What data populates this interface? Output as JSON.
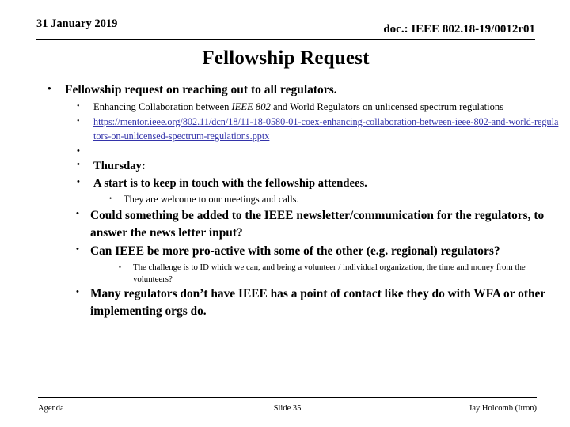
{
  "header": {
    "date": "31 January 2019",
    "doc": "doc.: IEEE 802.18-19/0012r01"
  },
  "title": "Fellowship Request",
  "content": {
    "b1": "Fellowship request on reaching out to all regulators.",
    "b1_1_pre": "Enhancing Collaboration between ",
    "b1_1_ital": "IEEE 802",
    "b1_1_post": " and World Regulators on unlicensed spectrum regulations",
    "b1_2_link": "https://mentor.ieee.org/802.11/dcn/18/11-18-0580-01-coex-enhancing-collaboration-between-ieee-802-and-world-regulators-on-unlicensed-spectrum-regulations.pptx",
    "b1_3_empty": "",
    "b1_4": "Thursday:",
    "b1_5": " A start is to keep in touch with the fellowship attendees.",
    "b1_5_1": "They are welcome to our meetings and calls.",
    "b1_6": "Could something be added to the IEEE newsletter/communication for the regulators, to answer the news letter input?",
    "b1_7": "Can IEEE be more pro-active with some of the other (e.g. regional) regulators?",
    "b1_7_1": "The challenge is to ID which we can, and being a volunteer  / individual organization, the time and money from the volunteers?",
    "b1_8": "Many regulators don’t have IEEE has a point of contact like they do with WFA or other implementing orgs do."
  },
  "bullets": {
    "disc": "•",
    "disc_small": "•",
    "square": "▪"
  },
  "footer": {
    "left": "Agenda",
    "middle": "Slide 35",
    "right": "Jay Holcomb (Itron)"
  },
  "colors": {
    "link": "#3333aa",
    "text": "#000000",
    "background": "#ffffff"
  }
}
